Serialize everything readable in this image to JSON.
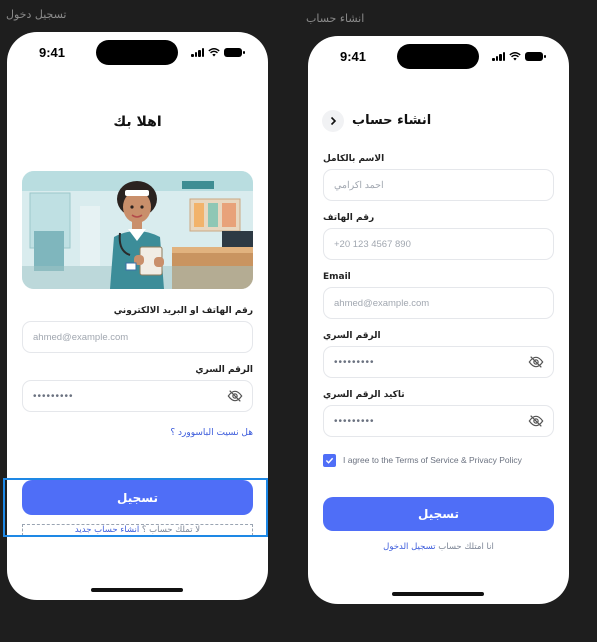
{
  "frames": {
    "login_label": "تسجيل دخول",
    "register_label": "انشاء حساب"
  },
  "status_bar": {
    "time": "9:41"
  },
  "login": {
    "title": "اهلا بك",
    "illustration": "nurse-illustration",
    "identifier_label": "رقم الهاتف او البريد الالكتروني",
    "identifier_placeholder": "ahmed@example.com",
    "password_label": "الرقم السري",
    "password_value": "•••••••••",
    "forgot_link": "هل نسيت الباسوورد ؟",
    "submit_label": "تسجيل",
    "no_account_text": "لا تملك حساب ؟",
    "create_account_link": "انشاء حساب جديد"
  },
  "register": {
    "title": "انشاء حساب",
    "fullname_label": "الاسم بالكامل",
    "fullname_placeholder": "احمد اكرامي",
    "phone_label": "رقم الهاتف",
    "phone_placeholder": "+20 123 4567 890",
    "email_label": "Email",
    "email_placeholder": "ahmed@example.com",
    "password_label": "الرقم السري",
    "password_value": "•••••••••",
    "confirm_label": "تاكيد الرقم السري",
    "confirm_value": "•••••••••",
    "terms_text": "I agree to the Terms of Service & Privacy Policy",
    "terms_checked": true,
    "submit_label": "تسجيل",
    "have_account_text": "انا امتلك حساب",
    "login_link": "تسجيل الدخول"
  },
  "colors": {
    "accent": "#4f6ef7",
    "selection": "#1e88e5",
    "canvas": "#1e1e1e"
  },
  "icons": {
    "eye": "eye-off-icon",
    "back": "chevron-left-icon",
    "check": "check-icon"
  }
}
